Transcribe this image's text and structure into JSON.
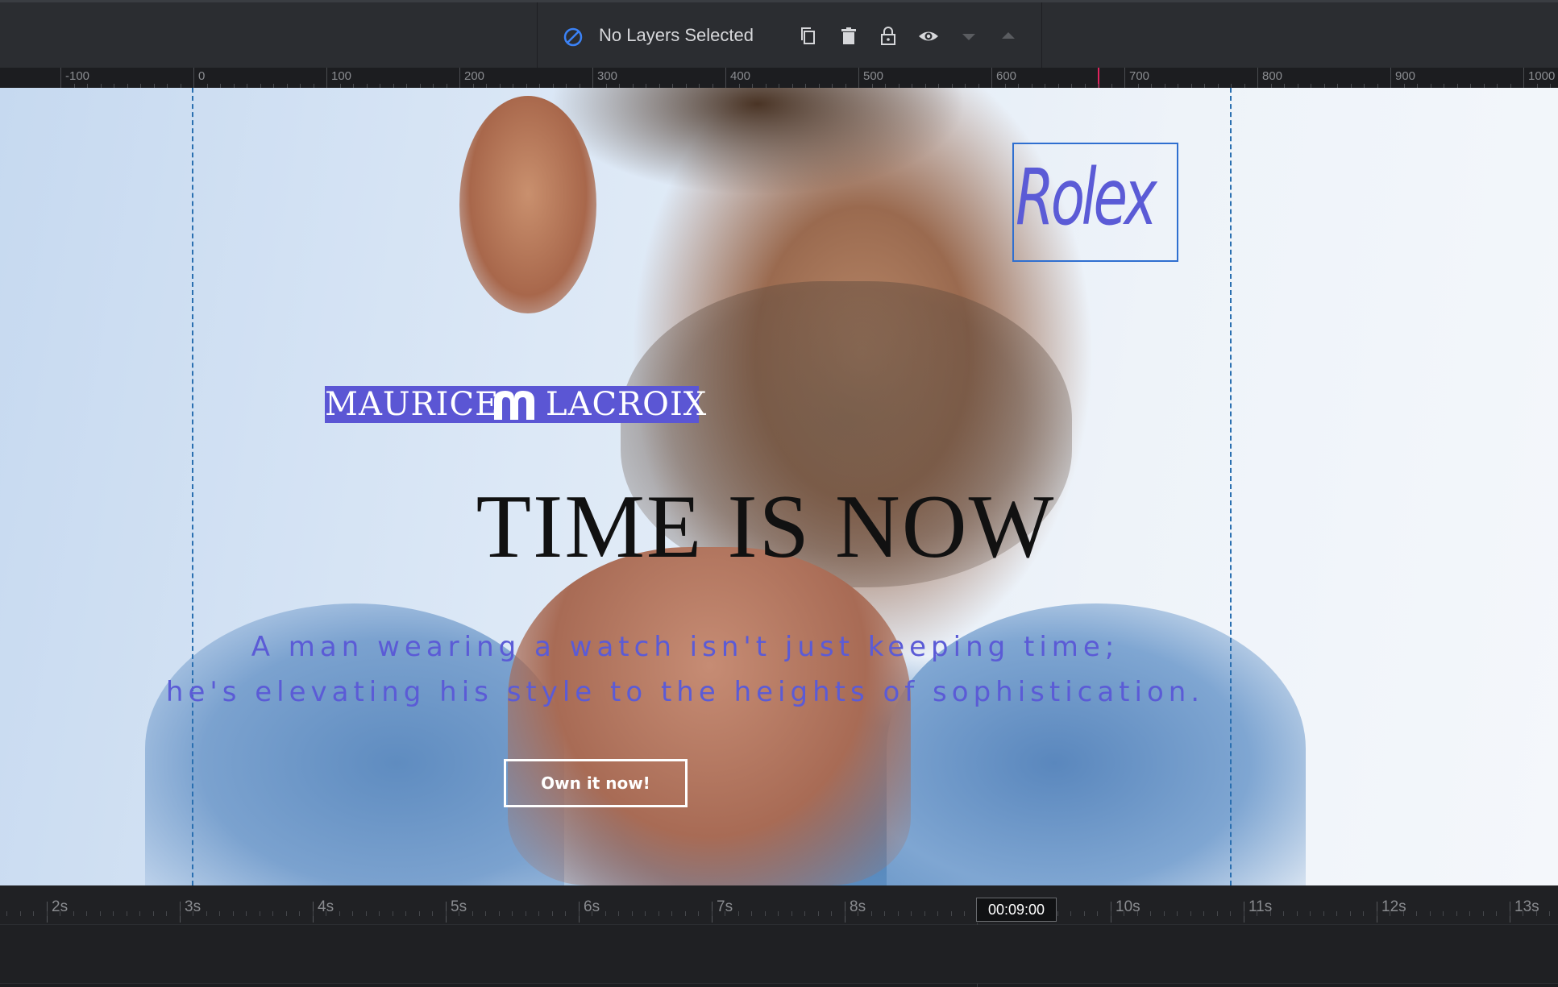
{
  "toolbar": {
    "selection_label": "No Layers Selected",
    "icons": [
      "no-selection-icon",
      "duplicate-icon",
      "delete-icon",
      "lock-icon",
      "visibility-icon",
      "move-down-icon",
      "move-up-icon"
    ]
  },
  "ruler": {
    "labels": [
      "-100",
      "0",
      "100",
      "200",
      "300",
      "400",
      "500",
      "600",
      "700",
      "800",
      "900",
      "1000"
    ]
  },
  "canvas": {
    "rolex_text": "Rolex",
    "logo_left": "MAURICE",
    "logo_right": "LACROIX",
    "headline": "TIME IS NOW",
    "subtitle_line1": "A man wearing a watch isn't just keeping time;",
    "subtitle_line2": "he's elevating his style to the heights of sophistication.",
    "cta_label": "Own it now!"
  },
  "timeline": {
    "labels": [
      "2s",
      "3s",
      "4s",
      "5s",
      "6s",
      "7s",
      "8s",
      "10s",
      "11s",
      "12s",
      "13s"
    ],
    "current_time": "00:09:00"
  },
  "colors": {
    "accent_purple": "#5b5bd6",
    "guide_blue": "#2a6fb0",
    "toolbar_bg": "#2b2d31"
  }
}
